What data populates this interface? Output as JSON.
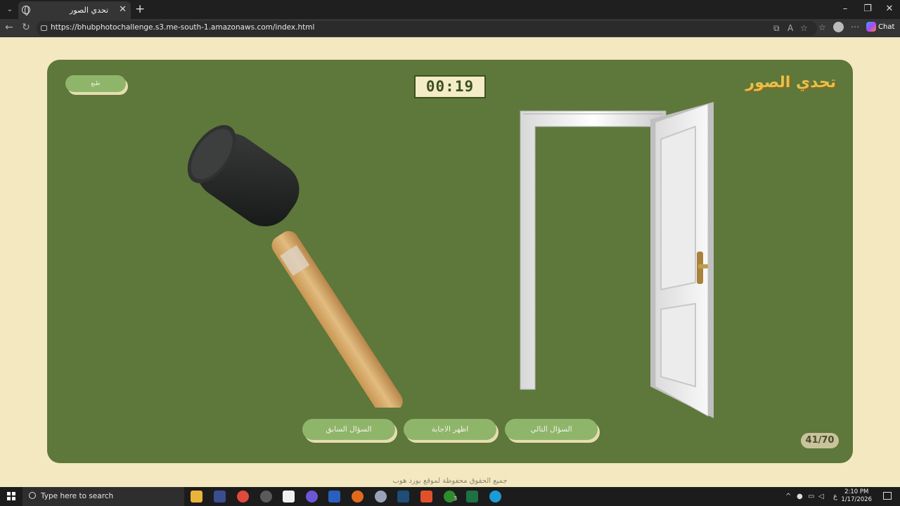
{
  "browser": {
    "tab_title": "تحدي الصور",
    "url": "https://bhubphotochallenge.s3.me-south-1.amazonaws.com/index.html",
    "chat_label": "Chat"
  },
  "game": {
    "title": "تحدي الصور",
    "timer": "00:19",
    "print_label": "طبع",
    "buttons": {
      "previous": "السؤال السابق",
      "show_answer": "اظهر الاجابة",
      "next": "السؤال التالي"
    },
    "counter": "41/70",
    "images": [
      "hammer",
      "door"
    ],
    "footer": "جميع الحقوق محفوظة لموقع بورد هوب"
  },
  "taskbar": {
    "search_placeholder": "Type here to search",
    "time": "2:10 PM",
    "date": "1/17/2026",
    "lang": "ع",
    "xbox_badge": "3"
  },
  "colors": {
    "card": "#5e773b",
    "page_bg": "#f3e8bf",
    "button": "#8fb56a",
    "title": "#e5c14a"
  }
}
